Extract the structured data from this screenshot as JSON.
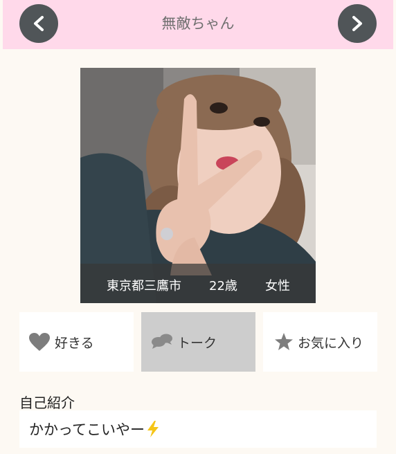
{
  "header": {
    "title": "無敵ちゃん",
    "prev_icon": "chevron-left-icon",
    "next_icon": "chevron-right-icon"
  },
  "profile": {
    "location": "東京都三鷹市",
    "age": "22歳",
    "gender": "女性"
  },
  "actions": {
    "like_label": "好きる",
    "talk_label": "トーク",
    "fav_label": "お気に入り"
  },
  "intro": {
    "label": "自己紹介",
    "text": "かかってこいやー"
  },
  "colors": {
    "header_bg": "#ffd9ea",
    "nav_button": "#505558",
    "page_bg": "#fdf9f3",
    "talk_bg": "#cdcdcd",
    "icon_gray": "#7d7d7d"
  }
}
